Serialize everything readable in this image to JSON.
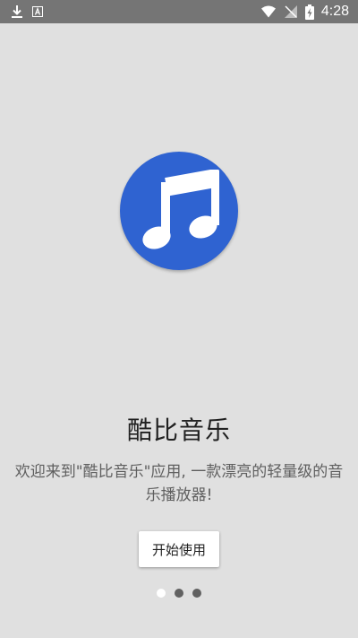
{
  "status_bar": {
    "time": "4:28",
    "left_icons": [
      "download-icon",
      "a-badge-icon"
    ],
    "right_icons": [
      "wifi-icon",
      "no-signal-icon",
      "battery-charging-icon"
    ]
  },
  "onboarding": {
    "logo_icon": "music-note-icon",
    "logo_color": "#2f63d1",
    "title": "酷比音乐",
    "description": "欢迎来到\"酷比音乐\"应用, 一款漂亮的轻量级的音乐播放器!",
    "start_button_label": "开始使用",
    "page_count": 3,
    "current_page": 1
  }
}
